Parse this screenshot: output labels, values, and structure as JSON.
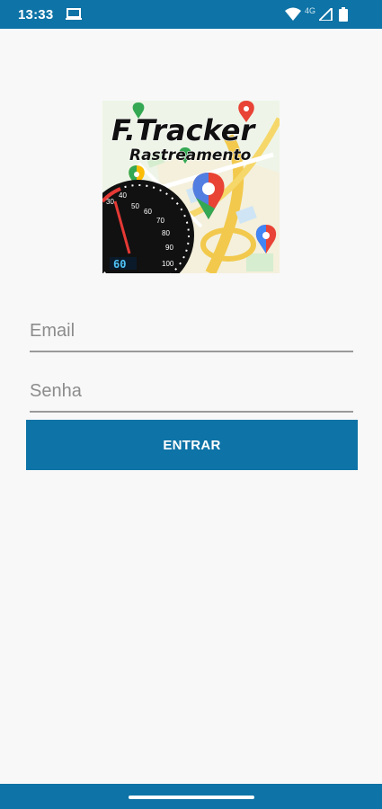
{
  "status_bar": {
    "time": "13:33",
    "network": "4G",
    "icons": [
      "laptop-icon",
      "wifi-icon",
      "signal-icon",
      "battery-icon"
    ]
  },
  "logo": {
    "title": "F.Tracker",
    "subtitle": "Rastreamento",
    "speedometer_ticks": [
      "30",
      "40",
      "50",
      "60",
      "70",
      "80",
      "90",
      "100"
    ],
    "speed_readout": "60"
  },
  "login_form": {
    "email_placeholder": "Email",
    "password_placeholder": "Senha",
    "submit_label": "ENTRAR"
  },
  "colors": {
    "primary": "#0e73a6",
    "background": "#f8f8f8"
  }
}
